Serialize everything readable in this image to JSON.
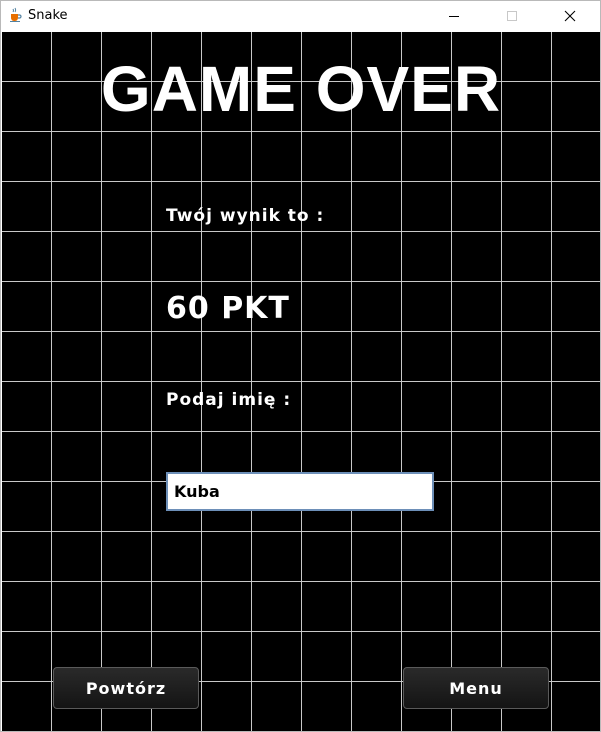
{
  "window": {
    "title": "Snake",
    "icon": "java-cup-icon"
  },
  "game": {
    "heading": "GAME OVER",
    "score_label": "Twój wynik to :",
    "score_value": "60 PKT",
    "name_label": "Podaj imię :",
    "name_value": "Kuba"
  },
  "buttons": {
    "retry_label": "Powtórz",
    "menu_label": "Menu"
  },
  "colors": {
    "background": "#000000",
    "grid_lines": "#c8c8c8",
    "text": "#ffffff"
  }
}
